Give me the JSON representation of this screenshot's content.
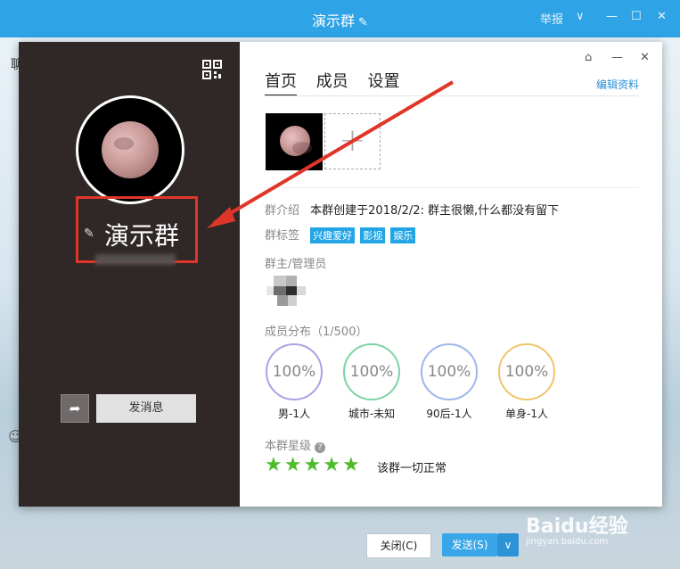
{
  "window": {
    "title": "演示群",
    "report": "举报",
    "edit_icon": "pencil-icon"
  },
  "bg": {
    "chat_tab": "聊",
    "close_btn": "关闭(C)",
    "send_btn": "发送(S)",
    "watermark": "Baidu经验",
    "watermark_sub": "jingyan.baidu.com"
  },
  "profile": {
    "group_name": "演示群",
    "send_message": "发消息"
  },
  "tabs": [
    "首页",
    "成员",
    "设置"
  ],
  "edit_profile": "编辑资料",
  "intro": {
    "label": "群介绍",
    "text": "本群创建于2018/2/2:  群主很懒,什么都没有留下"
  },
  "tags": {
    "label": "群标签",
    "items": [
      "兴趣爱好",
      "影视",
      "娱乐"
    ]
  },
  "admin_label": "群主/管理员",
  "distribution": {
    "label": "成员分布（1/500）",
    "items": [
      {
        "value": "100%",
        "label": "男-1人",
        "color": "#b29ee3"
      },
      {
        "value": "100%",
        "label": "城市-未知",
        "color": "#7dd3a6"
      },
      {
        "value": "100%",
        "label": "90后-1人",
        "color": "#9db8e9"
      },
      {
        "value": "100%",
        "label": "单身-1人",
        "color": "#f0c46b"
      }
    ]
  },
  "stars": {
    "label": "本群星级",
    "rating": 5,
    "status": "该群一切正常"
  },
  "colors": {
    "accent": "#2ea3e5",
    "tag": "#22a5e5",
    "highlight": "#e0362a",
    "star": "#4fbb2b"
  }
}
